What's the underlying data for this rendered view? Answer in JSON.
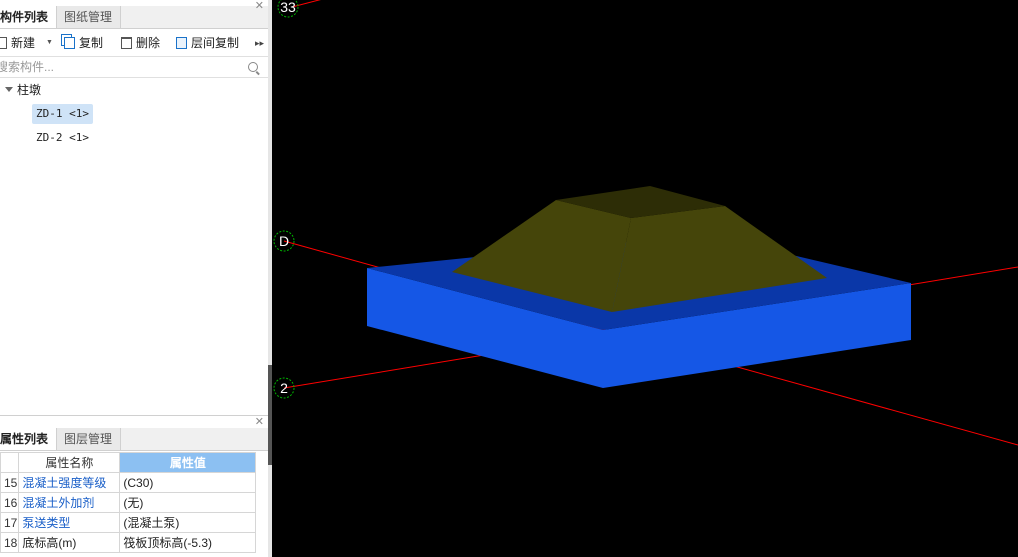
{
  "component_panel": {
    "tabs": [
      {
        "label": "构件列表",
        "active": true
      },
      {
        "label": "图纸管理",
        "active": false
      }
    ],
    "toolbar": {
      "new_label": "新建",
      "copy_label": "复制",
      "delete_label": "删除",
      "floor_copy_label": "层间复制"
    },
    "search": {
      "placeholder": "搜索构件..."
    },
    "tree": {
      "category": "柱墩",
      "items": [
        {
          "label": "ZD-1 <1>",
          "selected": true
        },
        {
          "label": "ZD-2 <1>",
          "selected": false
        }
      ]
    }
  },
  "property_panel": {
    "tabs": [
      {
        "label": "属性列表",
        "active": true
      },
      {
        "label": "图层管理",
        "active": false
      }
    ],
    "columns": {
      "name": "属性名称",
      "value": "属性值"
    },
    "rows": [
      {
        "num": "15",
        "name": "混凝土强度等级",
        "value": "(C30)",
        "link": true
      },
      {
        "num": "16",
        "name": "混凝土外加剂",
        "value": "(无)",
        "link": true
      },
      {
        "num": "17",
        "name": "泵送类型",
        "value": "(混凝土泵)",
        "link": true
      },
      {
        "num": "18",
        "name": "底标高(m)",
        "value": "筏板顶标高(-5.3)",
        "link": false
      }
    ]
  },
  "viewport": {
    "axis_labels": [
      "33",
      "D",
      "2"
    ],
    "colors": {
      "background": "#000000",
      "grid_line": "#ff0000",
      "axis_marker": "#00b400",
      "slab_top": "#0a37a8",
      "slab_front": "#1557e6",
      "slab_side": "#0e49c8",
      "pier": "#45450a",
      "pier_top": "#2d2d06"
    }
  }
}
